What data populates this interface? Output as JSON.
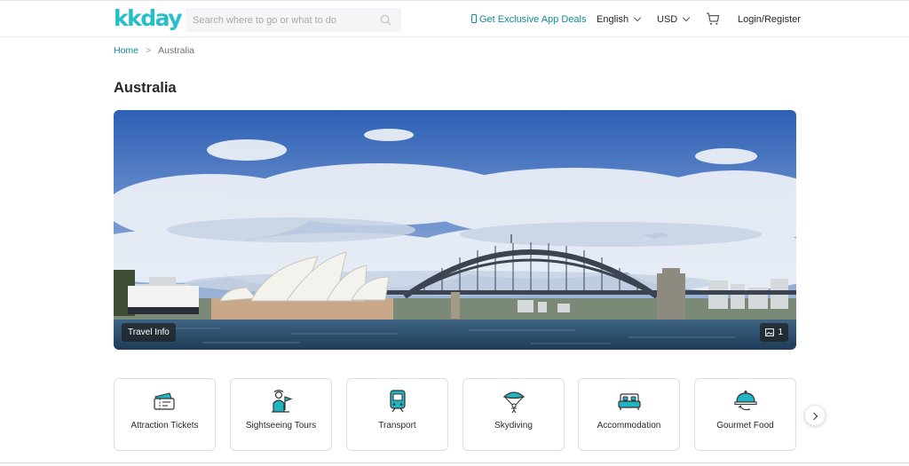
{
  "header": {
    "logo": "kkday",
    "search_placeholder": "Search where to go or what to do",
    "app_deals": "Get Exclusive App Deals",
    "language": "English",
    "currency": "USD",
    "login": "Login/Register"
  },
  "breadcrumb": {
    "home": "Home",
    "separator": ">",
    "current": "Australia"
  },
  "page_title": "Australia",
  "hero": {
    "travel_info": "Travel Info",
    "photo_count": "1"
  },
  "categories": [
    {
      "label": "Attraction Tickets",
      "icon": "ticket-icon"
    },
    {
      "label": "Sightseeing Tours",
      "icon": "tour-guide-icon"
    },
    {
      "label": "Transport",
      "icon": "train-icon"
    },
    {
      "label": "Skydiving",
      "icon": "parachute-icon"
    },
    {
      "label": "Accommodation",
      "icon": "bed-icon"
    },
    {
      "label": "Gourmet Food",
      "icon": "food-cloche-icon"
    }
  ],
  "colors": {
    "brand": "#26bec9",
    "link": "#0f8b9c",
    "icon_teal": "#1fb4c1"
  }
}
